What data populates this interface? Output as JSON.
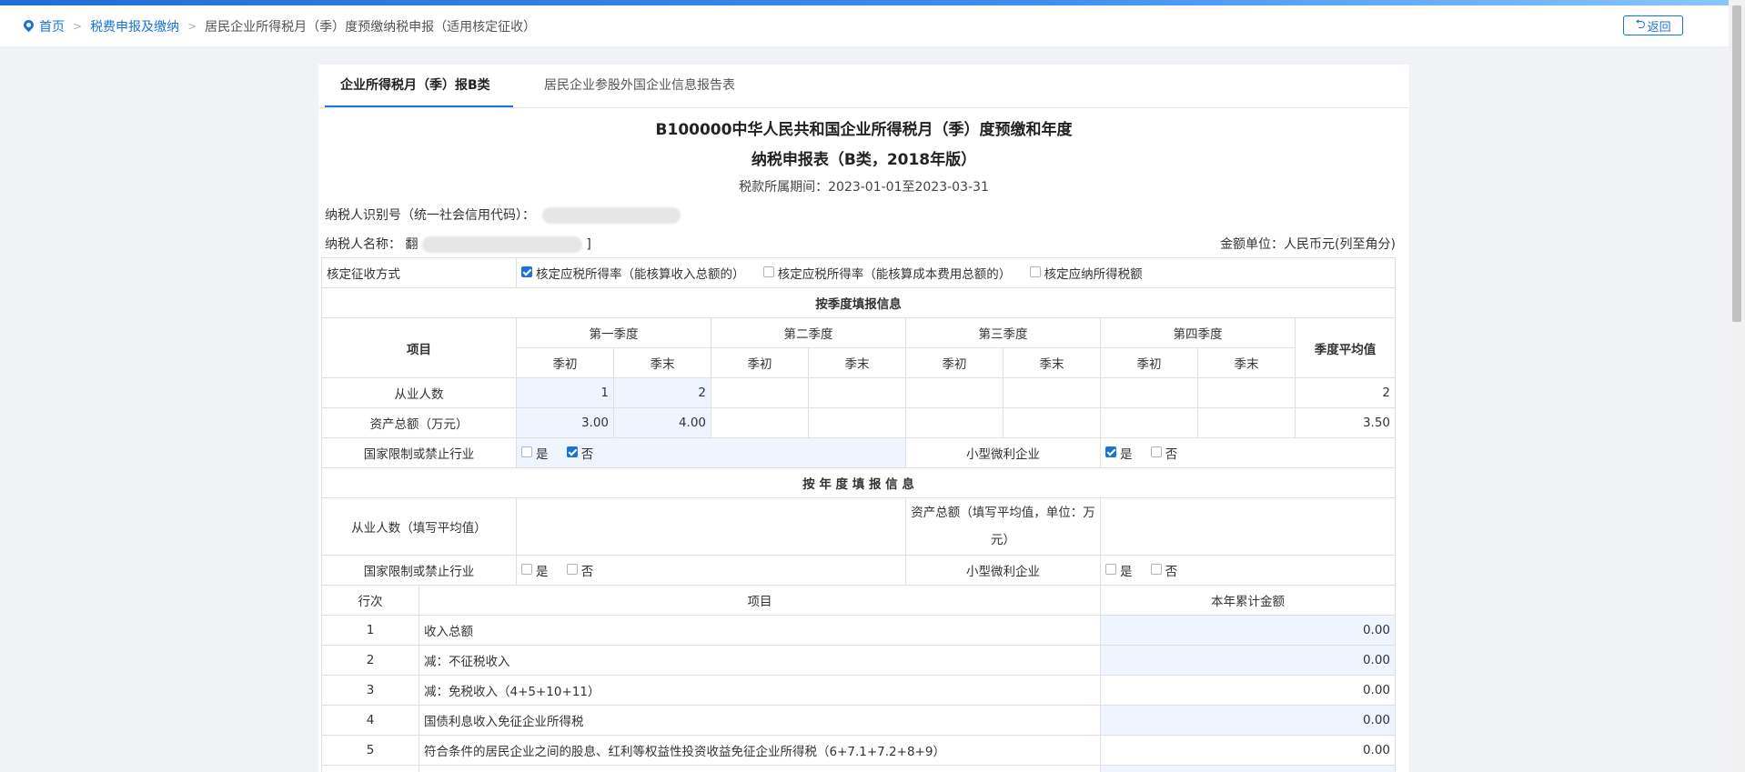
{
  "breadcrumb": {
    "home": "首页",
    "level2": "税费申报及缴纳",
    "current": "居民企业所得税月（季）度预缴纳税申报（适用核定征收）"
  },
  "back_label": "返回",
  "tabs": [
    {
      "label": "企业所得税月（季）报B类",
      "active": true
    },
    {
      "label": "居民企业参股外国企业信息报告表",
      "active": false
    }
  ],
  "form": {
    "title_line1": "B100000中华人民共和国企业所得税月（季）度预缴和年度",
    "title_line2": "纳税申报表（B类，2018年版）",
    "period": "税款所属期间：2023-01-01至2023-03-31",
    "taxpayer_id_label": "纳税人识别号（统一社会信用代码）：",
    "taxpayer_name_label": "纳税人名称：",
    "taxpayer_name_left": "翻",
    "taxpayer_name_right": "]",
    "currency_unit": "金额单位：人民币元(列至角分)"
  },
  "collection": {
    "label": "核定征收方式",
    "options": [
      {
        "label": "核定应税所得率（能核算收入总额的）",
        "checked": true
      },
      {
        "label": "核定应税所得率（能核算成本费用总额的）",
        "checked": false
      },
      {
        "label": "核定应纳所得税额",
        "checked": false
      }
    ]
  },
  "quarterly": {
    "section_title": "按季度填报信息",
    "item_header": "项目",
    "quarters": [
      "第一季度",
      "第二季度",
      "第三季度",
      "第四季度"
    ],
    "sub_start": "季初",
    "sub_end": "季末",
    "avg_header": "季度平均值",
    "employees_label": "从业人数",
    "employees": {
      "q1_start": "1",
      "q1_end": "2",
      "avg": "2"
    },
    "assets_label": "资产总额（万元）",
    "assets": {
      "q1_start": "3.00",
      "q1_end": "4.00",
      "avg": "3.50"
    },
    "restricted_label": "国家限制或禁止行业",
    "small_label": "小型微利企业",
    "yes": "是",
    "no": "否"
  },
  "annual": {
    "section_title": "按 年 度 填 报 信 息",
    "employees_label": "从业人数（填写平均值）",
    "assets_label": "资产总额（填写平均值，单位：万元）",
    "restricted_label": "国家限制或禁止行业",
    "small_label": "小型微利企业",
    "yes": "是",
    "no": "否"
  },
  "lines": {
    "header_row": "行次",
    "header_item": "项目",
    "header_amount": "本年累计金额",
    "rows": [
      {
        "no": "1",
        "item": "收入总额",
        "amount": "0.00",
        "editable": true
      },
      {
        "no": "2",
        "item": "减：不征税收入",
        "amount": "0.00",
        "editable": true
      },
      {
        "no": "3",
        "item": "减：免税收入（4+5+10+11）",
        "amount": "0.00",
        "editable": false
      },
      {
        "no": "4",
        "item": "国债利息收入免征企业所得税",
        "amount": "0.00",
        "editable": true
      },
      {
        "no": "5",
        "item": "符合条件的居民企业之间的股息、红利等权益性投资收益免征企业所得税（6+7.1+7.2+8+9）",
        "amount": "0.00",
        "editable": false
      }
    ]
  }
}
